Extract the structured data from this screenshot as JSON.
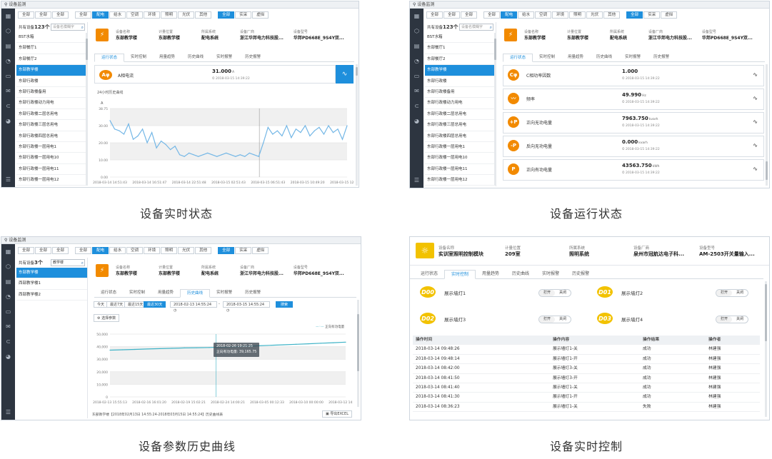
{
  "screen_title": "设备监测",
  "icons": [
    "grid-icon",
    "cube-icon",
    "document-icon",
    "bell-icon",
    "file-icon",
    "mail-icon",
    "link-icon",
    "pie-icon"
  ],
  "filters": {
    "group1": [
      "全部",
      "全部",
      "全部"
    ],
    "group2": [
      "全部",
      "配电",
      "给水",
      "空调",
      "环境",
      "照明",
      "光伏",
      "其他"
    ],
    "group3": [
      "全部",
      "实采",
      "虚拟"
    ]
  },
  "device_list": {
    "total_label": "共有设备",
    "total_count": "123个",
    "count_suffix": "个",
    "search_placeholder": "设备名模糊字",
    "items": [
      "BST水箱",
      "东部餐厅1",
      "东部餐厅2",
      "东部教学楼",
      "东部行政楼",
      "东部行政楼备用",
      "东部行政楼动力用电",
      "东部行政楼二层总用电",
      "东部行政楼三层总用电",
      "东部行政楼四层总用电",
      "东部行政楼一层用电1",
      "东部行政楼一层用电10",
      "东部行政楼一层用电11",
      "东部行政楼一层用电12"
    ]
  },
  "device_info": {
    "labels": [
      "设备名称",
      "计量位置",
      "所属系统",
      "设备厂商",
      "设备型号"
    ],
    "values": [
      "东部教学楼",
      "东部教学楼",
      "配电系统",
      "浙江华邦电力科技股...",
      "华邦PD668E_9S4Y双..."
    ]
  },
  "tabs": [
    "运行状态",
    "实时控制",
    "用量趋势",
    "历史曲线",
    "实时报警",
    "历史报警"
  ],
  "realtime": {
    "metric_name": "A相电流",
    "metric_value": "31.000",
    "metric_unit": "A",
    "metric_time": "2018-03-15 14:39:22",
    "chart_title": "24小时历史曲线"
  },
  "run_status": [
    {
      "icon": "Cφ",
      "name": "C相功率因数",
      "value": "1.000",
      "unit": "",
      "time": "2018-03-15 14:39:22"
    },
    {
      "icon": "〰",
      "name": "频率",
      "value": "49.990",
      "unit": "Hz",
      "time": "2018-03-15 14:39:22"
    },
    {
      "icon": "+P",
      "name": "正向无功电量",
      "value": "7963.750",
      "unit": "kvarh",
      "time": "2018-03-15 14:39:22"
    },
    {
      "icon": "-P",
      "name": "反向无功电量",
      "value": "0.000",
      "unit": "kvarh",
      "time": "2018-03-15 14:39:22"
    },
    {
      "icon": "P",
      "name": "正向有功电量",
      "value": "43563.750",
      "unit": "kWh",
      "time": "2018-03-15 14:39:22"
    }
  ],
  "history": {
    "total_label": "共有设备",
    "total_count": "3个",
    "search_value": "教学楼",
    "items": [
      "东部教学楼",
      "西部教学楼1",
      "西部教学楼2"
    ],
    "range_buttons": [
      "今天",
      "最近7天",
      "最近15天",
      "最近30天"
    ],
    "start": "2018-02-13 14:55:24",
    "end": "2018-03-15 14:55:24",
    "query": "搜索",
    "param_button": "选择参数",
    "legend": "正向有功电量",
    "tooltip_time": "2018-02-26 19:21:25",
    "tooltip_value": "正向有功电量: 39,165.75",
    "footer": "东部教学楼【2018年02月13日 14:55:24-2018年03月15日 14:55:24】历史曲线表",
    "export": "导出EXCEL"
  },
  "control": {
    "labels": [
      "设备名称",
      "计量位置",
      "所属系统",
      "设备厂商",
      "设备型号"
    ],
    "values": [
      "实训室照明控制模块",
      "209室",
      "照明系统",
      "泉州市冠航达电子科...",
      "AM-2503开关量输入..."
    ],
    "lamps": [
      {
        "code": "D00",
        "name": "展示墙灯1"
      },
      {
        "code": "D01",
        "name": "展示墙灯2"
      },
      {
        "code": "D02",
        "name": "展示墙灯3"
      },
      {
        "code": "D03",
        "name": "展示墙灯4"
      }
    ],
    "switch_on": "打开",
    "switch_off": "关闭",
    "log_headers": [
      "操作时间",
      "操作内容",
      "操作结果",
      "操作者"
    ],
    "logs": [
      [
        "2018-03-14 09:48:26",
        "展示墙灯1-关",
        "成功",
        "林建强"
      ],
      [
        "2018-03-14 09:48:14",
        "展示墙灯1-开",
        "成功",
        "林建强"
      ],
      [
        "2018-03-14 08:42:00",
        "展示墙灯3-关",
        "成功",
        "林建强"
      ],
      [
        "2018-03-14 08:41:50",
        "展示墙灯3-开",
        "成功",
        "林建强"
      ],
      [
        "2018-03-14 08:41:40",
        "展示墙灯1-关",
        "成功",
        "林建强"
      ],
      [
        "2018-03-14 08:41:30",
        "展示墙灯1-开",
        "成功",
        "林建强"
      ],
      [
        "2018-03-14 08:36:23",
        "展示墙灯1-关",
        "失败",
        "林建强"
      ]
    ]
  },
  "captions": [
    "设备实时状态",
    "设备运行状态",
    "设备参数历史曲线",
    "设备实时控制"
  ],
  "chart_data": [
    {
      "type": "line",
      "title": "24小时历史曲线",
      "ylabel": "A",
      "ylim": [
        0,
        40
      ],
      "yticks": [
        "0.00",
        "10.00",
        "20.00",
        "30.00",
        "38.75"
      ],
      "xticks": [
        "2018-03-14 14:51:43",
        "2018-03-14 16:51:47",
        "2018-03-14 22:51:48",
        "2018-03-15 02:51:43",
        "2018-03-15 06:51:43",
        "2018-03-15 10:49:20",
        "2018-03-15 12:51:23"
      ],
      "series": [
        {
          "values": [
            33,
            28,
            27,
            25,
            31,
            22,
            24,
            28,
            20,
            26,
            17,
            21,
            19,
            16,
            18,
            13,
            12,
            14,
            13,
            12,
            13,
            14,
            13,
            12,
            13,
            14,
            13,
            12,
            13,
            12,
            14,
            13,
            12,
            20,
            29,
            25,
            27,
            24,
            30,
            23,
            28,
            26,
            30,
            24,
            27,
            29,
            25,
            30,
            26,
            28,
            22,
            30
          ]
        }
      ],
      "grid": true
    },
    {
      "type": "line",
      "ylim": [
        0,
        50000
      ],
      "yticks": [
        "0",
        "10,000",
        "20,000",
        "30,000",
        "40,000",
        "50,000"
      ],
      "xticks": [
        "2018-02-13 15:55:13",
        "2018-02-16 16:01:20",
        "2018-02-19 15:02:21",
        "2018-02-24 14:00:21",
        "2018-03-05 00:12:33",
        "2018-03-10 00:00:00",
        "2018-03-12 14:11:00"
      ],
      "series": [
        {
          "name": "正向有功电量",
          "values": [
            37200,
            37500,
            37800,
            38100,
            38400,
            38700,
            39000,
            39165.75,
            39300,
            39600,
            39900,
            40300,
            40700,
            41100,
            41500,
            41900,
            42300,
            42700,
            43100,
            43563.75
          ]
        }
      ],
      "grid": true,
      "legend": "top-right"
    }
  ]
}
